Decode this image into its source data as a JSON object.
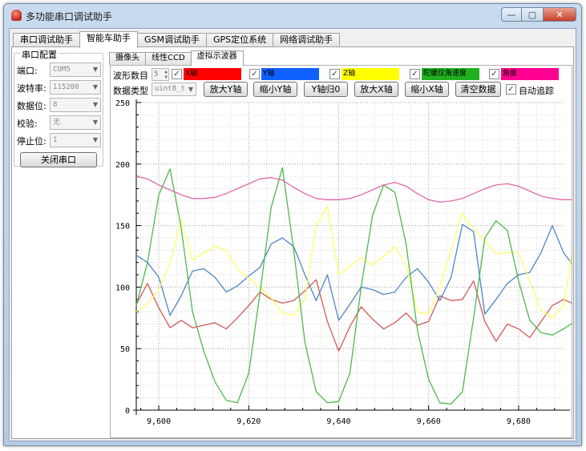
{
  "window": {
    "title": "多功能串口调试助手",
    "controls": {
      "minimize": "—",
      "maximize": "▢",
      "close": "✕"
    }
  },
  "main_tabs": [
    "串口调试助手",
    "智能车助手",
    "GSM调试助手",
    "GPS定位系统",
    "网络调试助手"
  ],
  "serial": {
    "group_title": "串口配置",
    "fields": [
      {
        "label": "端口:",
        "value": "COM5"
      },
      {
        "label": "波特率:",
        "value": "115200"
      },
      {
        "label": "数据位:",
        "value": "8"
      },
      {
        "label": "校验:",
        "value": "无"
      },
      {
        "label": "停止位:",
        "value": "1"
      }
    ],
    "close_button": "关闭串口"
  },
  "sub_tabs": [
    "摄像头",
    "线性CCD",
    "虚拟示波器"
  ],
  "osc": {
    "wave_count_label": "波形数目",
    "wave_count": "5",
    "channels": [
      {
        "name": "X轴",
        "color": "#ff0000"
      },
      {
        "name": "Y轴",
        "color": "#1060ff"
      },
      {
        "name": "Z轴",
        "color": "#ffff00"
      },
      {
        "name": "陀螺仪角速度",
        "color": "#20b020"
      },
      {
        "name": "角度",
        "color": "#ff0090"
      }
    ],
    "data_type_label": "数据类型",
    "data_type": "uint8_t",
    "buttons": {
      "zoom_in_y": "放大Y轴",
      "zoom_out_y": "缩小Y轴",
      "y_reset": "Y轴归0",
      "zoom_in_x": "放大X轴",
      "zoom_out_x": "缩小X轴",
      "clear": "清空数据"
    },
    "auto_track": "自动追踪"
  },
  "chart_data": {
    "type": "line",
    "x_ticks": [
      9600,
      9620,
      9640,
      9660,
      9680
    ],
    "x_tick_labels": [
      "9,600",
      "9,620",
      "9,640",
      "9,660",
      "9,680"
    ],
    "y_ticks": [
      0,
      50,
      100,
      150,
      200,
      250
    ],
    "xlim": [
      9595,
      9690
    ],
    "ylim": [
      0,
      250
    ],
    "x_start": 9595,
    "x_step": 2.5,
    "grid": true,
    "series": [
      {
        "color": "#d05a5a",
        "values": [
          86,
          103,
          83,
          67,
          73,
          67,
          69,
          71,
          66,
          75,
          85,
          96,
          90,
          87,
          89,
          97,
          106,
          72,
          48,
          68,
          84,
          74,
          66,
          71,
          79,
          69,
          72,
          93,
          89,
          90,
          105,
          72,
          56,
          70,
          66,
          59,
          72,
          85,
          90,
          86,
          88,
          85,
          68,
          66,
          73,
          76,
          72,
          69
        ]
      },
      {
        "color": "#4f86c8",
        "values": [
          126,
          120,
          108,
          77,
          93,
          113,
          115,
          108,
          96,
          101,
          109,
          116,
          135,
          140,
          133,
          110,
          89,
          110,
          73,
          86,
          100,
          98,
          94,
          96,
          108,
          115,
          104,
          89,
          108,
          151,
          145,
          78,
          90,
          103,
          110,
          112,
          128,
          150,
          128,
          116,
          104,
          106,
          104,
          108,
          102,
          114,
          108,
          101
        ]
      },
      {
        "color": "#ffff66",
        "values": [
          80,
          86,
          98,
          120,
          155,
          122,
          128,
          133,
          130,
          115,
          107,
          100,
          91,
          79,
          77,
          90,
          150,
          166,
          110,
          117,
          124,
          118,
          125,
          133,
          118,
          80,
          78,
          100,
          130,
          160,
          147,
          138,
          127,
          128,
          128,
          105,
          81,
          75,
          85,
          142,
          132,
          118,
          128,
          106,
          116,
          112,
          114,
          116
        ]
      },
      {
        "color": "#4fb84f",
        "values": [
          85,
          120,
          175,
          196,
          148,
          80,
          48,
          23,
          8,
          6,
          30,
          95,
          165,
          197,
          130,
          55,
          15,
          6,
          7,
          30,
          100,
          158,
          183,
          177,
          135,
          65,
          25,
          6,
          5,
          15,
          75,
          140,
          154,
          146,
          105,
          73,
          63,
          61,
          66,
          72,
          74,
          70,
          68,
          70,
          72,
          70,
          72,
          71
        ]
      },
      {
        "color": "#e06aa5",
        "values": [
          190,
          188,
          183,
          179,
          175,
          172,
          172,
          173,
          176,
          180,
          184,
          188,
          189,
          187,
          181,
          176,
          172,
          171,
          171,
          172,
          175,
          179,
          183,
          185,
          182,
          176,
          171,
          169,
          170,
          172,
          176,
          180,
          183,
          184,
          182,
          178,
          174,
          172,
          171,
          171,
          172,
          172,
          173,
          173,
          173,
          173,
          173,
          173
        ]
      }
    ]
  }
}
